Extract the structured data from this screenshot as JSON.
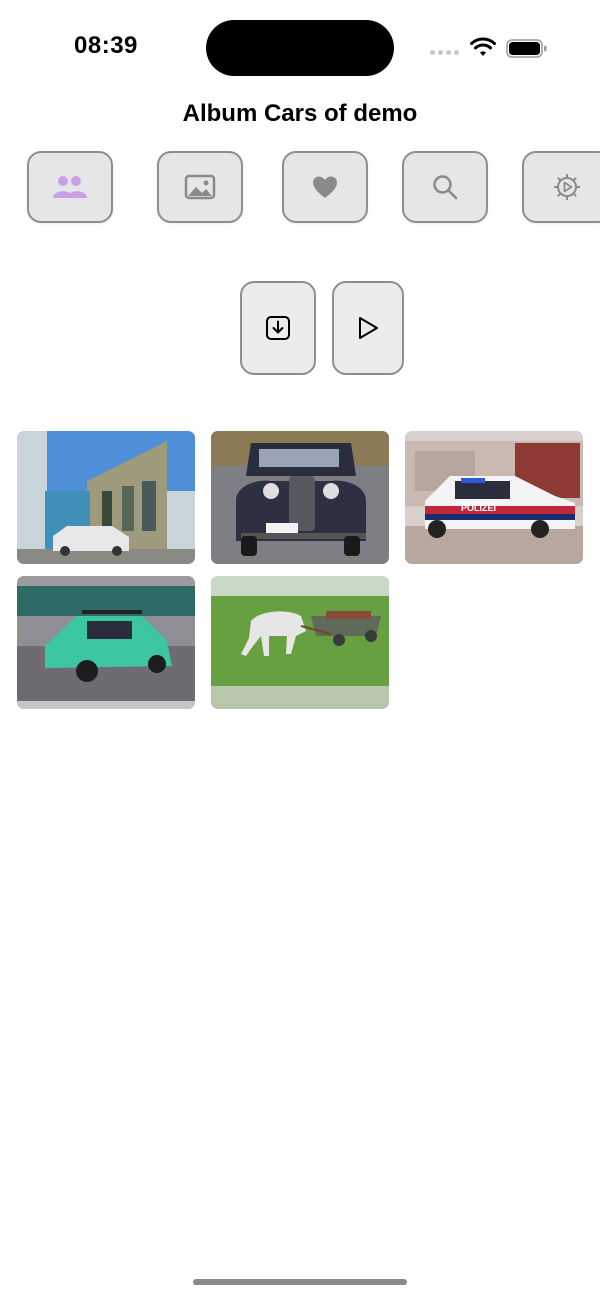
{
  "status_bar": {
    "time": "08:39"
  },
  "header": {
    "title": "Album Cars of demo"
  },
  "toolbar": {
    "buttons": [
      {
        "icon": "people-icon",
        "accent": "#c9a0e8"
      },
      {
        "icon": "photo-icon"
      },
      {
        "icon": "heart-icon"
      },
      {
        "icon": "search-icon"
      },
      {
        "icon": "gear-icon"
      }
    ]
  },
  "actions": [
    {
      "icon": "download-icon"
    },
    {
      "icon": "play-icon"
    }
  ],
  "photos": [
    {
      "subject": "old-car-street"
    },
    {
      "subject": "vintage-car"
    },
    {
      "subject": "police-car",
      "text": "POLIZEI"
    },
    {
      "subject": "green-car"
    },
    {
      "subject": "horse-cart"
    }
  ],
  "colors": {
    "button_bg": "#e6e6e8",
    "button_border": "#8e8e8e",
    "icon_gray": "#8a8a8a"
  }
}
